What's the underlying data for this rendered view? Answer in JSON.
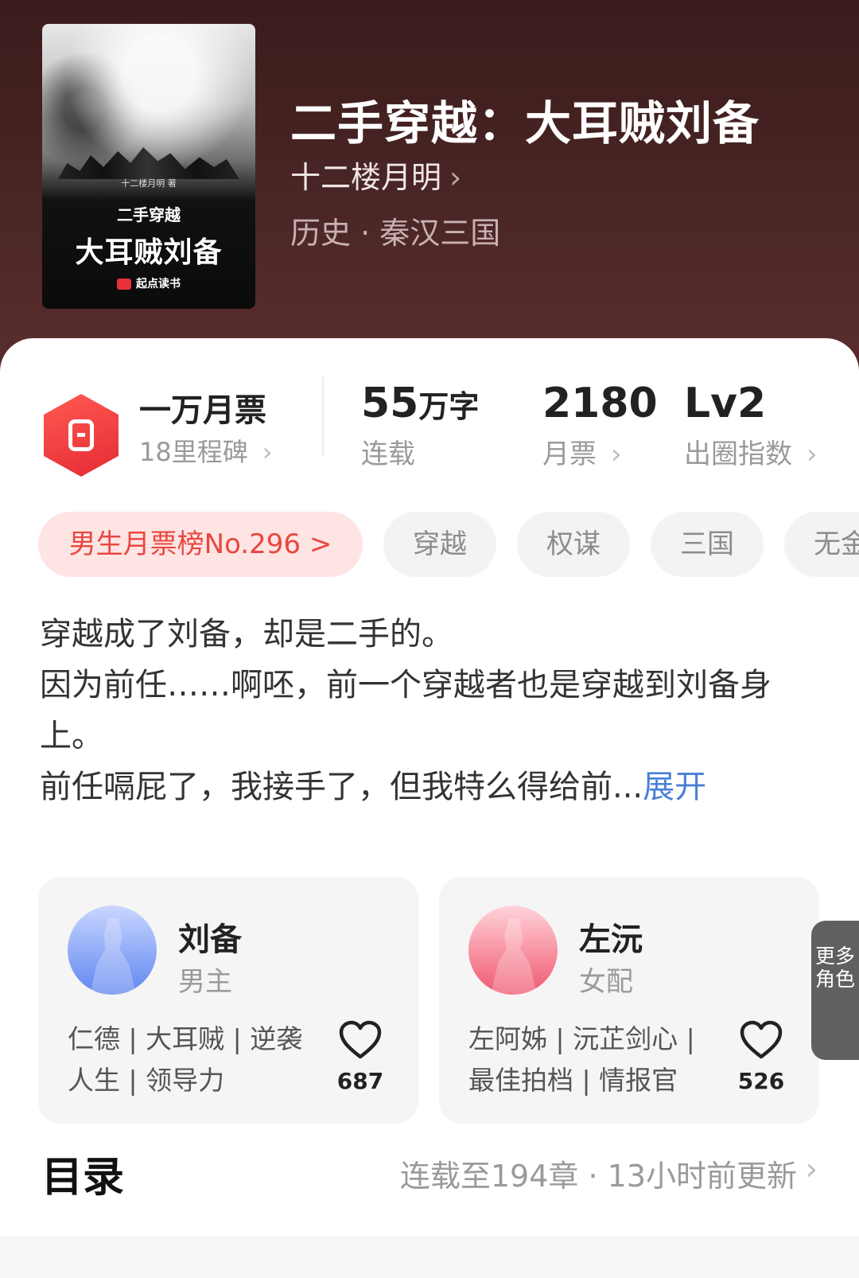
{
  "book": {
    "title": "二手穿越：大耳贼刘备",
    "author": "十二楼月明",
    "category": "历史 · 秦汉三国",
    "cover": {
      "author_line": "十二楼月明 著",
      "subtitle": "二手穿越",
      "main_title": "大耳贼刘备",
      "publisher": "起点读书"
    }
  },
  "stats": {
    "monthly_ticket_title": "一万月票",
    "milestones": "18里程碑",
    "word_count_value": "55",
    "word_count_unit": "万字",
    "word_count_label": "连载",
    "tickets_value": "2180",
    "tickets_label": "月票",
    "level_value": "Lv2",
    "level_label": "出圈指数"
  },
  "tags": [
    "男生月票榜No.296 >",
    "穿越",
    "权谋",
    "三国",
    "无金"
  ],
  "intro": {
    "line1": "穿越成了刘备，却是二手的。",
    "line2": "因为前任……啊呸，前一个穿越者也是穿越到刘备身上。",
    "line3": "前任嗝屁了，我接手了，但我特么得给前...",
    "expand": "展开"
  },
  "characters": [
    {
      "name": "刘备",
      "role": "男主",
      "tags": "仁德 | 大耳贼 | 逆袭人生 | 领导力",
      "likes": "687",
      "color_top": "#c9d6ff",
      "color_bottom": "#5f86f0"
    },
    {
      "name": "左沅",
      "role": "女配",
      "tags": "左阿姊 | 沅芷剑心 | 最佳拍档 | 情报官",
      "likes": "526",
      "color_top": "#ffd3da",
      "color_bottom": "#f0586f"
    }
  ],
  "more_roles": "更多角色",
  "toc": {
    "title": "目录",
    "info": "连载至194章 · 13小时前更新"
  },
  "colors": {
    "accent_red": "#e8473f",
    "link_blue": "#4a7fd8"
  }
}
